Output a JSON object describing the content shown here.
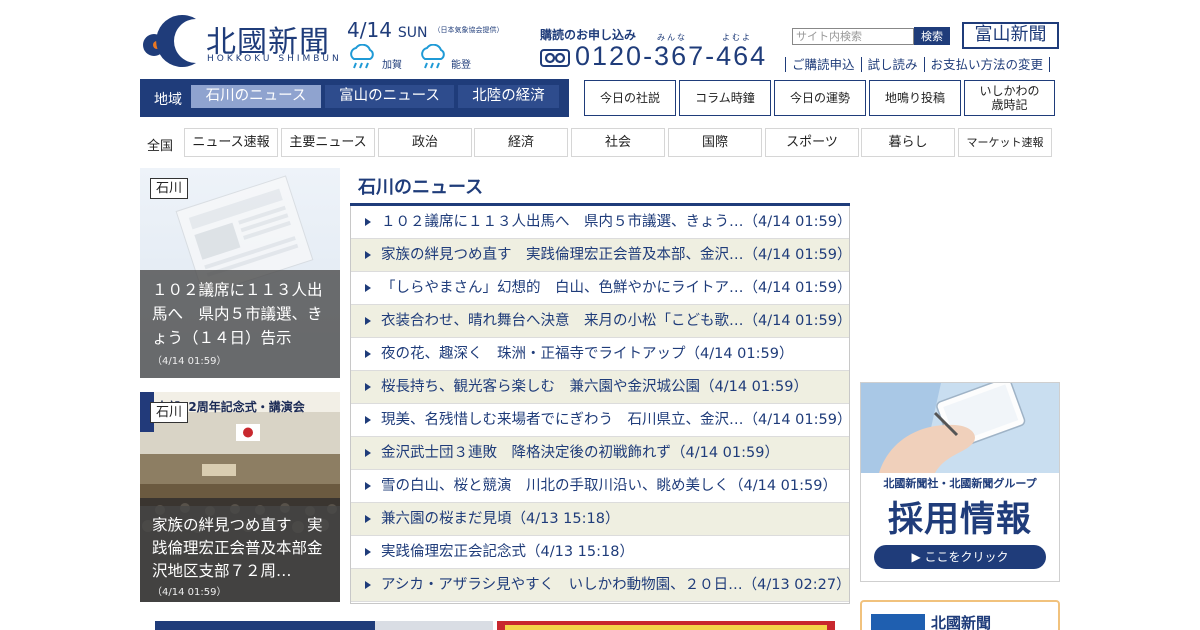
{
  "header": {
    "logo": {
      "title": "北國新聞",
      "subtitle": "HOKKOKU SHIMBUN"
    },
    "date": {
      "month_day": "4/14",
      "day_of_week": "SUN",
      "note": "（日本気象協会提供）"
    },
    "weather": [
      {
        "region": "加賀",
        "icon": "rain-cloud-icon"
      },
      {
        "region": "能登",
        "icon": "rain-cloud-icon"
      }
    ],
    "subscription": {
      "title": "購読のお申し込み",
      "phone_icon": "free-dial-icon",
      "phone": "0120-367-464",
      "ruby": [
        "みんな",
        "よむよ"
      ]
    },
    "search": {
      "placeholder": "サイト内検索",
      "button_label": "検索"
    },
    "toyama_link": "富山新聞",
    "sub_links": [
      "ご購読申込",
      "試し読み",
      "お支払い方法の変更"
    ]
  },
  "region_nav": {
    "label": "地域",
    "tabs": [
      {
        "label": "石川のニュース",
        "active": true
      },
      {
        "label": "富山のニュース",
        "active": false
      },
      {
        "label": "北陸の経済",
        "active": false
      }
    ]
  },
  "top_buttons": [
    "今日の社説",
    "コラム時鐘",
    "今日の運勢",
    "地鳴り投稿",
    "いしかわの\n歳時記"
  ],
  "categories": {
    "all_label": "全国",
    "tabs": [
      "ニュース速報",
      "主要ニュース",
      "政治",
      "経済",
      "社会",
      "国際",
      "スポーツ",
      "暮らし",
      "マーケット速報"
    ]
  },
  "feature_cards": [
    {
      "badge": "石川",
      "headline": "１０２議席に１１３人出馬へ　県内５市議選、きょう（１４日）告示",
      "time": "（4/14 01:59）",
      "image": "newspaper-placeholder"
    },
    {
      "badge": "石川",
      "headline": "家族の絆見つめ直す　実践倫理宏正会普及本部金沢地区支部７２周…",
      "time": "（4/14 01:59）",
      "image": "ceremony-photo",
      "photo_banner": "支部72周年記念式・講演会"
    }
  ],
  "news": {
    "title": "石川のニュース",
    "items": [
      {
        "text": "１０２議席に１１３人出馬へ　県内５市議選、きょう…（4/14 01:59）"
      },
      {
        "text": "家族の絆見つめ直す　実践倫理宏正会普及本部、金沢…（4/14 01:59）"
      },
      {
        "text": "「しらやまさん」幻想的　白山、色鮮やかにライトア…（4/14 01:59）"
      },
      {
        "text": "衣装合わせ、晴れ舞台へ決意　来月の小松「こども歌…（4/14 01:59）"
      },
      {
        "text": "夜の花、趣深く　珠洲・正福寺でライトアップ（4/14 01:59）"
      },
      {
        "text": "桜長持ち、観光客ら楽しむ　兼六園や金沢城公園（4/14 01:59）"
      },
      {
        "text": "現美、名残惜しむ来場者でにぎわう　石川県立、金沢…（4/14 01:59）"
      },
      {
        "text": "金沢武士団３連敗　降格決定後の初戦飾れず（4/14 01:59）"
      },
      {
        "text": "雪の白山、桜と競演　川北の手取川沿い、眺め美しく（4/14 01:59）"
      },
      {
        "text": "兼六園の桜まだ見頃（4/13 15:18）"
      },
      {
        "text": "実践倫理宏正会記念式（4/13 15:18）"
      },
      {
        "text": "アシカ・アザラシ見やすく　いしかわ動物園、２０日…（4/13 02:27）"
      }
    ]
  },
  "recruit_banner": {
    "company": "北國新聞社・北國新聞グループ",
    "main": "採用情報",
    "cta": "▶ ここをクリック"
  },
  "paper_box": {
    "name": "北國新聞"
  },
  "colors": {
    "brand": "#1f3c7a",
    "active_tab": "#8fa3cf",
    "row_alt": "#efefe1",
    "banner_border": "#f1c27d"
  }
}
